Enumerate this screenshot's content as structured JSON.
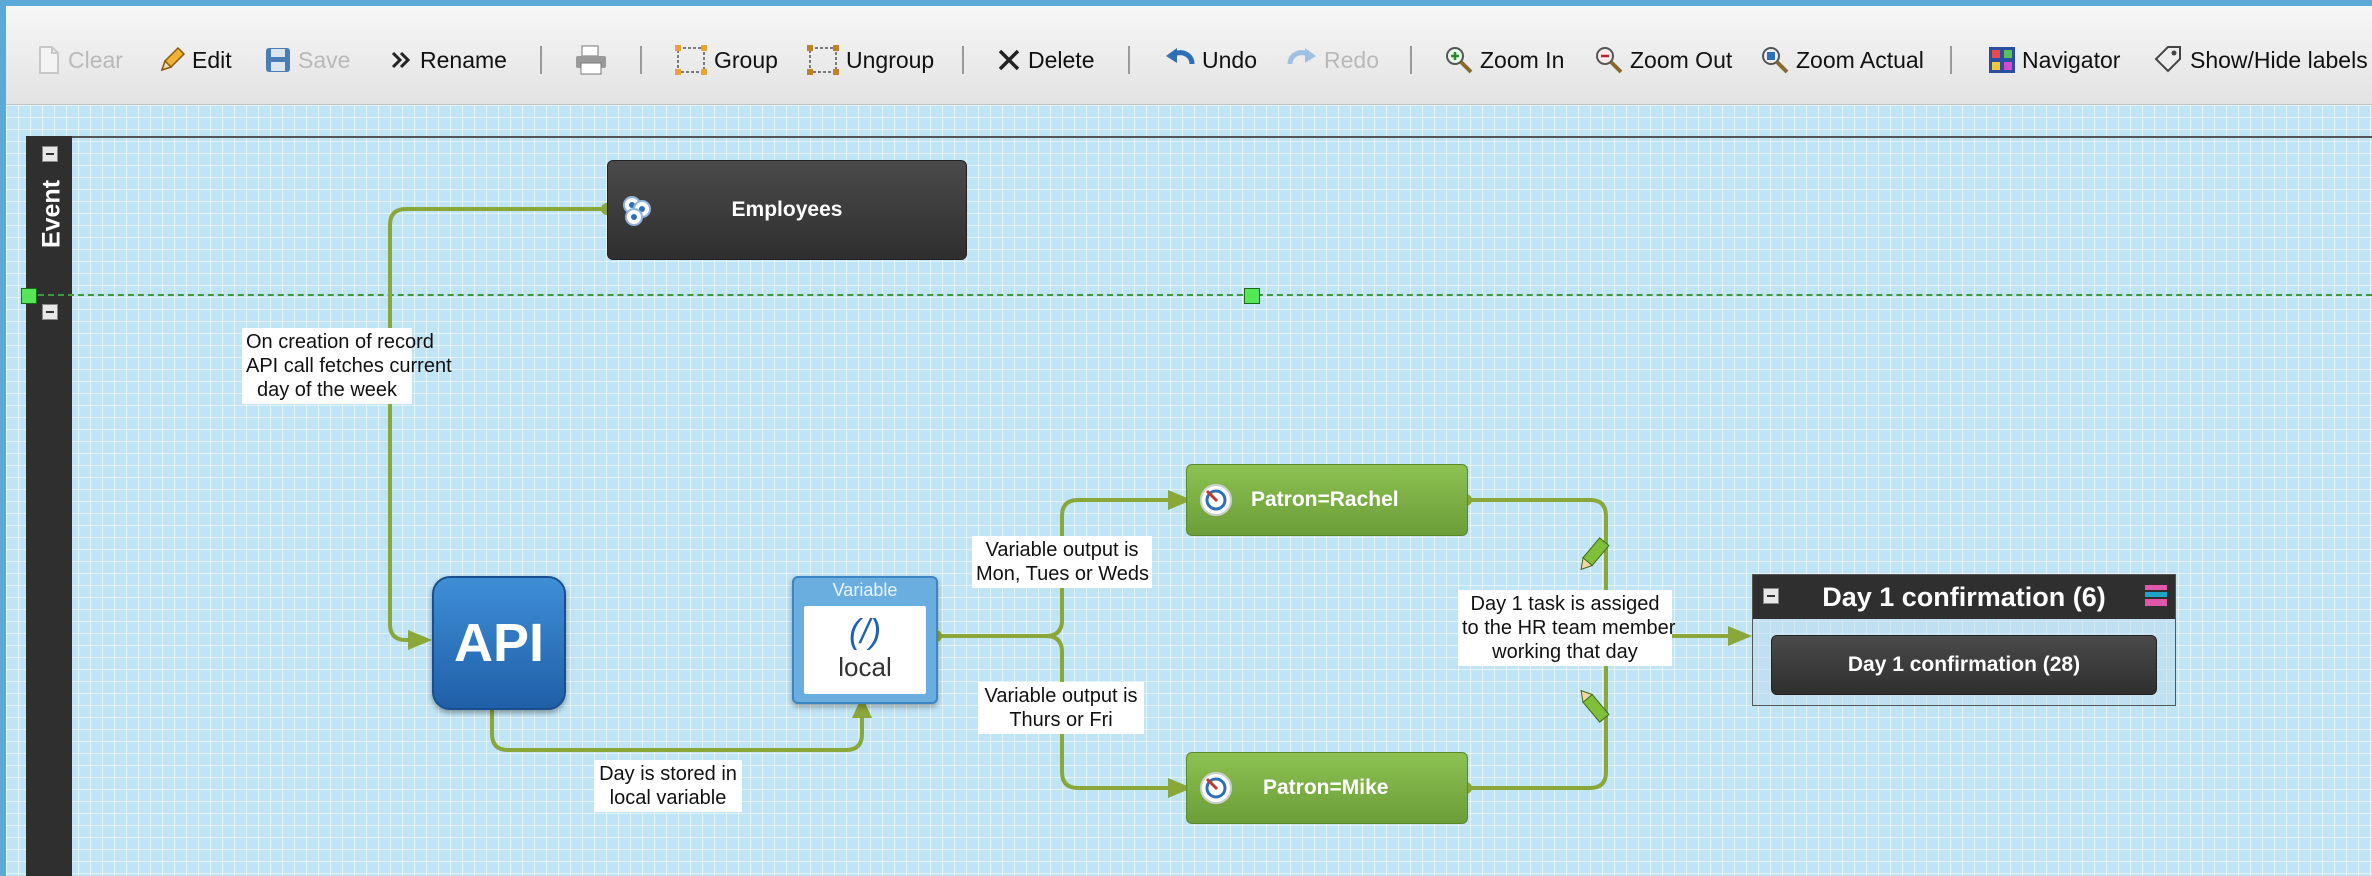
{
  "toolbar": {
    "clear": "Clear",
    "edit": "Edit",
    "save": "Save",
    "rename": "Rename",
    "group": "Group",
    "ungroup": "Ungroup",
    "delete": "Delete",
    "undo": "Undo",
    "redo": "Redo",
    "zoom_in": "Zoom In",
    "zoom_out": "Zoom Out",
    "zoom_actual": "Zoom Actual",
    "navigator": "Navigator",
    "show_hide_labels": "Show/Hide labels"
  },
  "lane": {
    "title": "Event"
  },
  "nodes": {
    "employees": "Employees",
    "api": "API",
    "variable_header": "Variable",
    "variable_symbol": "(/)",
    "variable_name": "local",
    "patron_rachel": "Patron=Rachel",
    "patron_mike": "Patron=Mike",
    "group_title": "Day 1 confirmation (6)",
    "group_task": "Day 1 confirmation (28)"
  },
  "edge_labels": {
    "api_call": "On creation of record\nAPI call fetches current\nday of the week",
    "stored": "Day is stored in\nlocal variable",
    "mon_weds": "Variable output is\nMon, Tues or Weds",
    "thurs_fri": "Variable output is\nThurs or Fri",
    "assigned": "Day 1 task is assiged\nto the HR team member\nworking that day"
  },
  "colors": {
    "edge": "#8aa83a",
    "canvas": "#bfe4f5",
    "dark_node": "#3a3a3a",
    "green_node": "#7cb342",
    "api_blue": "#2a72c0"
  },
  "icons": {
    "clear": "document-icon",
    "edit": "pencil-icon",
    "save": "floppy-icon",
    "rename": "double-chevron-icon",
    "print": "printer-icon",
    "group": "group-icon",
    "ungroup": "ungroup-icon",
    "delete": "x-icon",
    "undo": "undo-icon",
    "redo": "redo-icon",
    "zoom_in": "zoom-in-icon",
    "zoom_out": "zoom-out-icon",
    "zoom_actual": "zoom-actual-icon",
    "navigator": "navigator-icon",
    "labels": "tag-icon"
  }
}
